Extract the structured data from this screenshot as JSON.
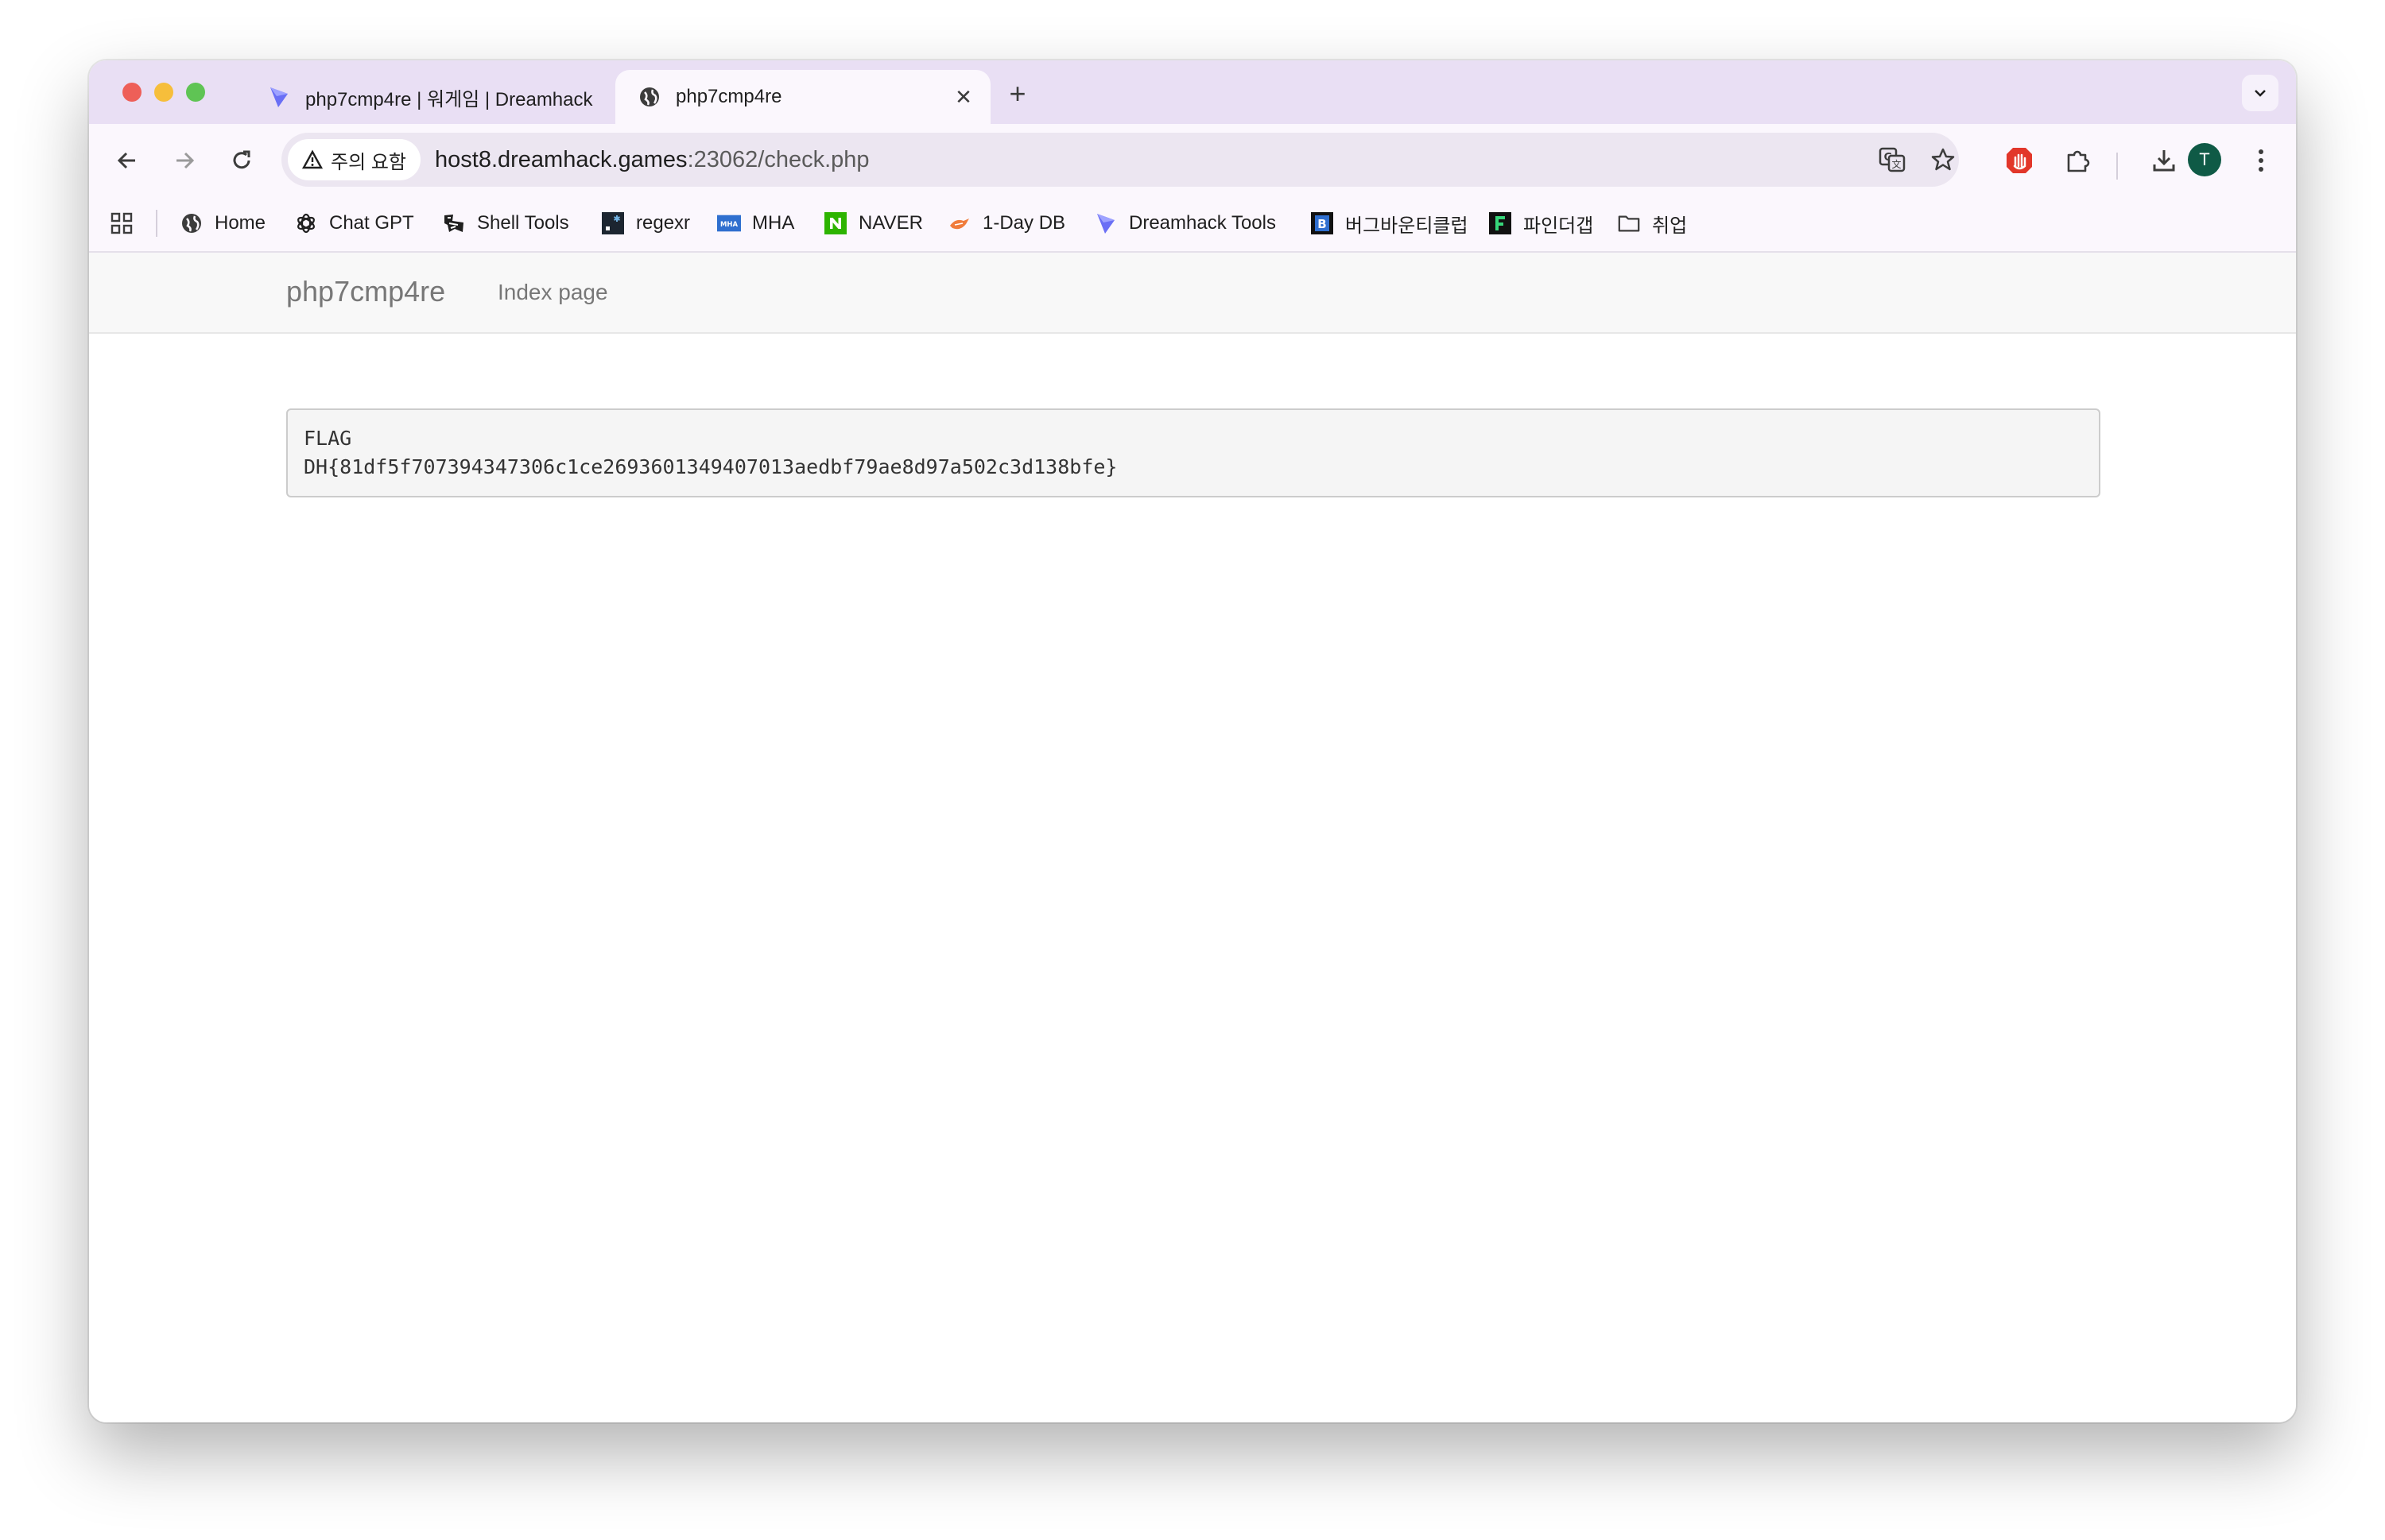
{
  "browser": {
    "tabs": [
      {
        "title": "php7cmp4re | 워게임 | Dreamhack",
        "active": false
      },
      {
        "title": "php7cmp4re",
        "active": true
      }
    ],
    "security_label": "주의 요함",
    "url_host": "host8.dreamhack.games",
    "url_path": ":23062/check.php",
    "avatar_initial": "T",
    "bookmarks": [
      {
        "label": "Home",
        "icon": "globe-icon"
      },
      {
        "label": "Chat GPT",
        "icon": "openai-icon"
      },
      {
        "label": "Shell Tools",
        "icon": "shell-tools-icon"
      },
      {
        "label": "regexr",
        "icon": "regexr-icon"
      },
      {
        "label": "MHA",
        "icon": "mha-icon"
      },
      {
        "label": "NAVER",
        "icon": "naver-icon"
      },
      {
        "label": "1-Day DB",
        "icon": "oneday-icon"
      },
      {
        "label": "Dreamhack Tools",
        "icon": "dreamhack-icon"
      },
      {
        "label": "버그바운티클럽",
        "icon": "bugbounty-icon"
      },
      {
        "label": "파인더갭",
        "icon": "findthegap-icon"
      },
      {
        "label": "취업",
        "icon": "folder-icon"
      }
    ]
  },
  "page": {
    "brand": "php7cmp4re",
    "nav_link": "Index page",
    "flag_label": "FLAG",
    "flag_value": "DH{81df5f707394347306c1ce2693601349407013aedbf79ae8d97a502c3d138bfe}"
  },
  "colors": {
    "tabstrip_bg": "#e9dff4",
    "toolbar_bg": "#fbf7fd",
    "omnibox_bg": "#ece6f1",
    "avatar_bg": "#0f5a46",
    "dreamhack_accent": "#6a6ff5",
    "naver_green": "#2db400"
  }
}
